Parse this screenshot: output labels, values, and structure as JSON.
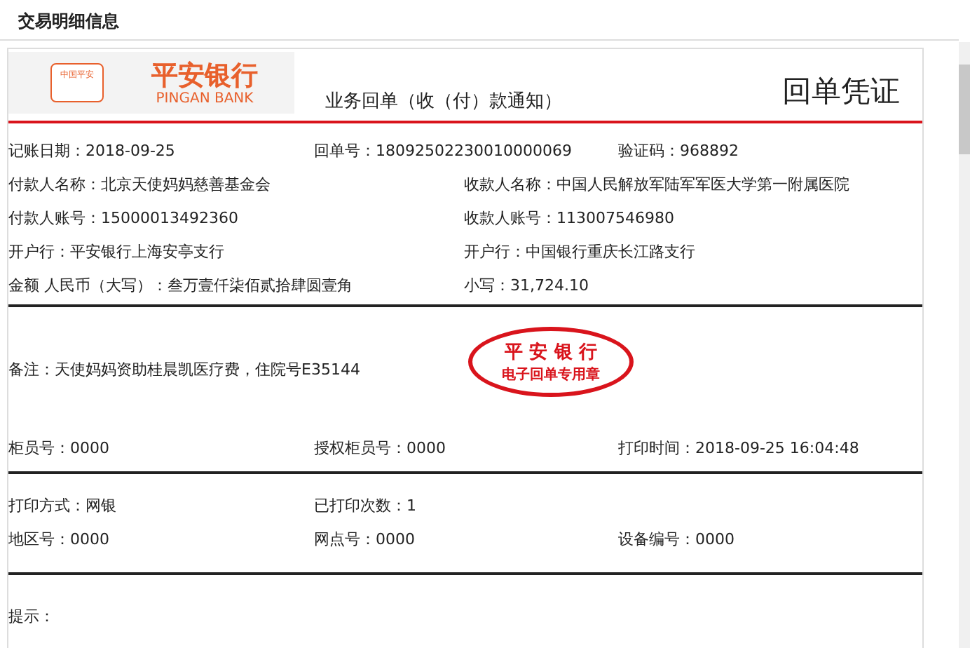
{
  "page_title": "交易明细信息",
  "receipt": {
    "logo": {
      "badge": "中国平安",
      "name_cn": "平安银行",
      "name_en": "PINGAN BANK"
    },
    "notice_title": "业务回单（收（付）款通知）",
    "voucher_title": "回单凭证",
    "main_rows": [
      {
        "kind": "three",
        "cells": [
          "记账日期：2018-09-25",
          "回单号：18092502230010000069",
          "验证码：968892"
        ]
      },
      {
        "kind": "two",
        "cells": [
          "付款人名称：北京天使妈妈慈善基金会",
          "收款人名称：中国人民解放军陆军军医大学第一附属医院"
        ]
      },
      {
        "kind": "two",
        "cells": [
          "付款人账号：15000013492360",
          "收款人账号：113007546980"
        ]
      },
      {
        "kind": "two",
        "cells": [
          "开户行：平安银行上海安亭支行",
          "开户行：中国银行重庆长江路支行"
        ]
      },
      {
        "kind": "two",
        "cells": [
          "金额 人民币（大写）：叁万壹仟柒佰贰拾肆圆壹角",
          "小写：31,724.10"
        ]
      }
    ],
    "remark": "备注：天使妈妈资助桂晨凯医疗费，住院号E35144",
    "stamp": {
      "line1": "平 安 银 行",
      "line2": "电子回单专用章"
    },
    "staff_row": {
      "kind": "three",
      "cells": [
        "柜员号：0000",
        "授权柜员号：0000",
        "打印时间：2018-09-25 16:04:48"
      ]
    },
    "print_rows": [
      {
        "kind": "three",
        "cells": [
          "打印方式：网银",
          "已打印次数：1"
        ]
      },
      {
        "kind": "three",
        "cells": [
          "地区号：0000",
          "网点号：0000",
          "设备编号：0000"
        ]
      }
    ],
    "tips_label": "提示："
  }
}
